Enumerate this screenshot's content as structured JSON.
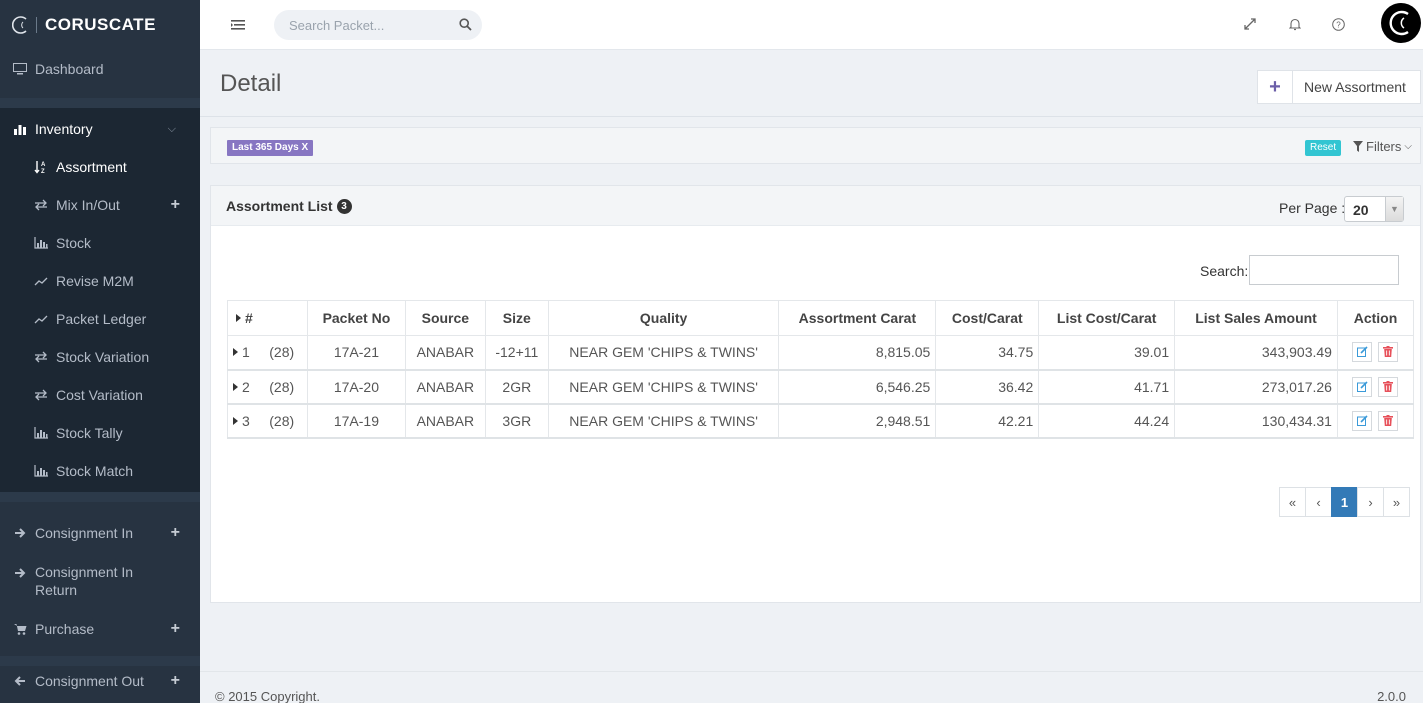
{
  "brand": {
    "name": "CORUSCATE"
  },
  "sidebar": {
    "dashboard": "Dashboard",
    "inventory": "Inventory",
    "inventory_items": [
      {
        "label": "Assortment",
        "icon": "sort-alpha-icon"
      },
      {
        "label": "Mix In/Out",
        "icon": "exchange-icon"
      },
      {
        "label": "Stock",
        "icon": "bar-chart-icon"
      },
      {
        "label": "Revise M2M",
        "icon": "line-chart-icon"
      },
      {
        "label": "Packet Ledger",
        "icon": "line-chart-icon"
      },
      {
        "label": "Stock Variation",
        "icon": "exchange-icon"
      },
      {
        "label": "Cost Variation",
        "icon": "exchange-icon"
      },
      {
        "label": "Stock Tally",
        "icon": "bar-chart-icon"
      },
      {
        "label": "Stock Match",
        "icon": "bar-chart-icon"
      }
    ],
    "consignment_in": "Consignment In",
    "consignment_in_return_1": "Consignment In",
    "consignment_in_return_2": "Return",
    "purchase": "Purchase",
    "consignment_out": "Consignment Out"
  },
  "header": {
    "search_placeholder": "Search Packet..."
  },
  "page": {
    "title": "Detail",
    "new_button": "New Assortment"
  },
  "filters": {
    "chip": "Last 365 Days X",
    "reset": "Reset",
    "filters_label": "Filters"
  },
  "list": {
    "title": "Assortment List",
    "count": "3",
    "per_page_label": "Per Page :",
    "per_page_value": "20",
    "search_label": "Search:"
  },
  "table": {
    "headers": [
      "#",
      "Packet No",
      "Source",
      "Size",
      "Quality",
      "Assortment Carat",
      "Cost/Carat",
      "List Cost/Carat",
      "List Sales Amount",
      "Action"
    ],
    "rows": [
      {
        "num": "1",
        "sub": "(28)",
        "packet": "17A-21",
        "source": "ANABAR",
        "size": "-12+11",
        "quality": "NEAR GEM 'CHIPS & TWINS'",
        "carat": "8,815.05",
        "cost": "34.75",
        "list_cost": "39.01",
        "sales": "343,903.49"
      },
      {
        "num": "2",
        "sub": "(28)",
        "packet": "17A-20",
        "source": "ANABAR",
        "size": "2GR",
        "quality": "NEAR GEM 'CHIPS & TWINS'",
        "carat": "6,546.25",
        "cost": "36.42",
        "list_cost": "41.71",
        "sales": "273,017.26"
      },
      {
        "num": "3",
        "sub": "(28)",
        "packet": "17A-19",
        "source": "ANABAR",
        "size": "3GR",
        "quality": "NEAR GEM 'CHIPS & TWINS'",
        "carat": "2,948.51",
        "cost": "42.21",
        "list_cost": "44.24",
        "sales": "130,434.31"
      }
    ]
  },
  "pagination": {
    "first": "«",
    "prev": "‹",
    "current": "1",
    "next": "›",
    "last": "»"
  },
  "footer": {
    "copyright": "© 2015 Copyright.",
    "version": "2.0.0"
  }
}
